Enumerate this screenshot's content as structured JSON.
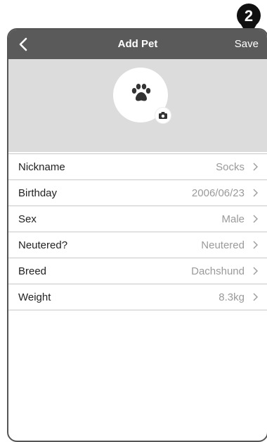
{
  "callout": {
    "number": "2"
  },
  "navbar": {
    "title": "Add Pet",
    "save_label": "Save"
  },
  "avatar": {
    "icon": "paw-icon",
    "badge_icon": "camera-icon"
  },
  "fields": [
    {
      "label": "Nickname",
      "value": "Socks"
    },
    {
      "label": "Birthday",
      "value": "2006/06/23"
    },
    {
      "label": "Sex",
      "value": "Male"
    },
    {
      "label": "Neutered?",
      "value": "Neutered"
    },
    {
      "label": "Breed",
      "value": "Dachshund"
    },
    {
      "label": "Weight",
      "value": "8.3kg"
    }
  ],
  "colors": {
    "navbar": "#5a5a5a",
    "header_bg": "#dcdcdc",
    "value_text": "#9a9a9a"
  }
}
